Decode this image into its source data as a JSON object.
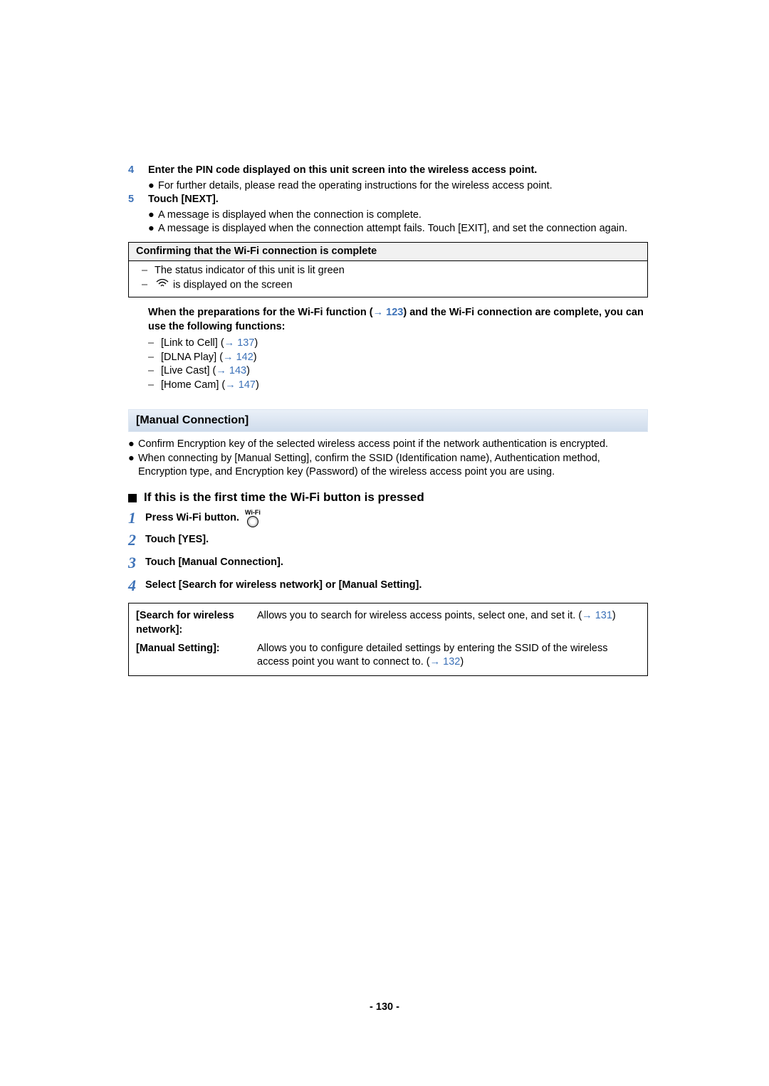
{
  "step4": {
    "num": "4",
    "text": "Enter the PIN code displayed on this unit screen into the wireless access point.",
    "bullet": "For further details, please read the operating instructions for the wireless access point."
  },
  "step5": {
    "num": "5",
    "text": "Touch [NEXT].",
    "b1": "A message is displayed when the connection is complete.",
    "b2": "A message is displayed when the connection attempt fails. Touch [EXIT], and set the connection again."
  },
  "confirm": {
    "head": "Confirming that the Wi-Fi connection is complete",
    "l1": "The status indicator of this unit is lit green",
    "l2a": " is displayed on the screen"
  },
  "prep": {
    "intro_a": "When the preparations for the Wi-Fi function (",
    "intro_link": "123",
    "intro_b": ") and the Wi-Fi connection are complete, you can use the following functions:",
    "f1": "[Link to Cell] (",
    "f1l": "137",
    "f2": "[DLNA Play] (",
    "f2l": "142",
    "f3": "[Live Cast] (",
    "f3l": "143",
    "f4": "[Home Cam] (",
    "f4l": "147"
  },
  "section": "[Manual Connection]",
  "mc_b1": "Confirm Encryption key of the selected wireless access point if the network authentication is encrypted.",
  "mc_b2": "When connecting by [Manual Setting], confirm the SSID (Identification name), Authentication method, Encryption type, and Encryption key (Password) of the wireless access point you are using.",
  "heading": "If this is the first time the Wi-Fi button is pressed",
  "s1": {
    "n": "1",
    "t": "Press Wi-Fi button.",
    "wlbl": "Wi-Fi"
  },
  "s2": {
    "n": "2",
    "t": "Touch [YES]."
  },
  "s3": {
    "n": "3",
    "t": "Touch [Manual Connection]."
  },
  "s4": {
    "n": "4",
    "t": "Select [Search for wireless network] or [Manual Setting]."
  },
  "opt1": {
    "label": "[Search for wireless network]:",
    "desc": "Allows you to search for wireless access points, select one, and set it. (",
    "link": "131",
    "tail": ")"
  },
  "opt2": {
    "label": "[Manual Setting]:",
    "desc": "Allows you to configure detailed settings by entering the SSID of the wireless access point you want to connect to. (",
    "link": "132",
    "tail": ")"
  },
  "pagenum": "- 130 -",
  "arrow": "→",
  "dash": "–",
  "bullet": "●",
  "close_paren": ")"
}
